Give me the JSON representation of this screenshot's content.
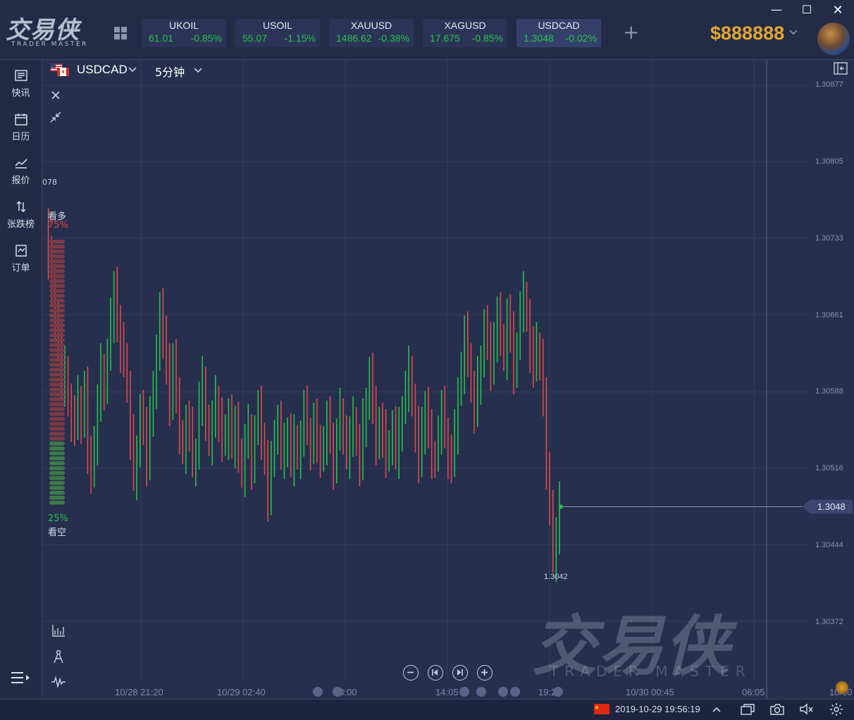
{
  "app": {
    "logo_cn": "交易侠",
    "logo_en": "TRADER MASTER"
  },
  "window_controls": {
    "minimize": "—",
    "maximize": "☐",
    "close": "✕"
  },
  "tickers": [
    {
      "symbol": "UKOIL",
      "price": "61.01",
      "change": "-0.85%"
    },
    {
      "symbol": "USOIL",
      "price": "55.07",
      "change": "-1.15%"
    },
    {
      "symbol": "XAUUSD",
      "price": "1486.62",
      "change": "-0.38%"
    },
    {
      "symbol": "XAGUSD",
      "price": "17.675",
      "change": "-0.85%"
    },
    {
      "symbol": "USDCAD",
      "price": "1.3048",
      "change": "-0.02%",
      "active": true
    }
  ],
  "add_ticker": "+",
  "account": {
    "balance": "$888888"
  },
  "sidebar": {
    "items": [
      {
        "label": "快讯",
        "icon": "news-icon"
      },
      {
        "label": "日历",
        "icon": "calendar-icon"
      },
      {
        "label": "报价",
        "icon": "quote-chart-icon"
      },
      {
        "label": "张跌榜",
        "icon": "updown-arrows-icon"
      },
      {
        "label": "订单",
        "icon": "order-icon"
      }
    ]
  },
  "chart_header": {
    "symbol": "USDCAD",
    "timeframe": "5分钟"
  },
  "sentiment": {
    "bull_label": "看多",
    "bull_pct": "75%",
    "bear_label": "看空",
    "bear_pct": "25%",
    "bull_fraction": 0.75,
    "edge_value": "078"
  },
  "current_price_label": "1.3048",
  "low_label": "1.3042",
  "watermark": {
    "cn": "交易侠",
    "en": "TRADER MASTER"
  },
  "status": {
    "datetime": "2019-10-29 19:56:19",
    "flag": "china-flag-icon"
  },
  "colors": {
    "up": "#27c24c",
    "down": "#e04b4b",
    "accent": "#e3a530",
    "bg": "#262f4d"
  },
  "chart_data": {
    "type": "candlestick",
    "symbol": "USDCAD",
    "timeframe": "5分钟",
    "y_ticks": [
      "1.30877",
      "1.30805",
      "1.30733",
      "1.30661",
      "1.30588",
      "1.30516",
      "1.30444",
      "1.30372"
    ],
    "x_ticks": [
      "10/28 21:20",
      "10/29 02:40",
      "08:00",
      "14:05",
      "19:25",
      "10/30 00:45",
      "06:05",
      "10/30"
    ],
    "ylim": [
      1.3032,
      1.3089
    ],
    "last_price": 1.3048,
    "low": 1.3042,
    "grid": true,
    "series_close": [
      1.30745,
      1.30715,
      1.30685,
      1.3066,
      1.30635,
      1.30595,
      1.3061,
      1.3058,
      1.30565,
      1.30555,
      1.3058,
      1.3056,
      1.3059,
      1.30535,
      1.3051,
      1.3054,
      1.30575,
      1.3061,
      1.30595,
      1.3062,
      1.30655,
      1.3069,
      1.3065,
      1.3063,
      1.3062,
      1.3059,
      1.30545,
      1.3051,
      1.30535,
      1.3057,
      1.3055,
      1.3052,
      1.3057,
      1.3059,
      1.3062,
      1.3067,
      1.3064,
      1.3061,
      1.3058,
      1.3062,
      1.3058,
      1.3055,
      1.30535,
      1.3056,
      1.3055,
      1.3052,
      1.3053,
      1.3058,
      1.306,
      1.3056,
      1.3054,
      1.3056,
      1.3058,
      1.30565,
      1.3054,
      1.30545,
      1.3057,
      1.3054,
      1.30555,
      1.3053,
      1.3051,
      1.3054,
      1.30555,
      1.3052,
      1.3055,
      1.3057,
      1.30545,
      1.30525,
      1.3049,
      1.3052,
      1.3055,
      1.3056,
      1.3053,
      1.30535,
      1.3055,
      1.3052,
      1.30545,
      1.3053,
      1.30545,
      1.3057,
      1.3055,
      1.30535,
      1.3056,
      1.30545,
      1.30525,
      1.3054,
      1.3056,
      1.30545,
      1.3052,
      1.30545,
      1.3057,
      1.3055,
      1.3053,
      1.30545,
      1.3056,
      1.3054,
      1.3052,
      1.3056,
      1.3058,
      1.30605,
      1.3057,
      1.3054,
      1.3056,
      1.3055,
      1.30525,
      1.3054,
      1.30555,
      1.3053,
      1.3055,
      1.3057,
      1.3059,
      1.3061,
      1.3058,
      1.30555,
      1.3052,
      1.3055,
      1.30575,
      1.3055,
      1.3053,
      1.30525,
      1.3055,
      1.3057,
      1.3055,
      1.3053,
      1.3052,
      1.3055,
      1.3059,
      1.3061,
      1.3064,
      1.3062,
      1.3059,
      1.3057,
      1.306,
      1.3062,
      1.3065,
      1.3063,
      1.3061,
      1.3064,
      1.3066,
      1.3064,
      1.3062,
      1.3066,
      1.3064,
      1.3061,
      1.3063,
      1.30665,
      1.3068,
      1.3066,
      1.3063,
      1.3061,
      1.3063,
      1.3062,
      1.3058,
      1.3052,
      1.3048,
      1.3043,
      1.3045,
      1.3048
    ]
  }
}
